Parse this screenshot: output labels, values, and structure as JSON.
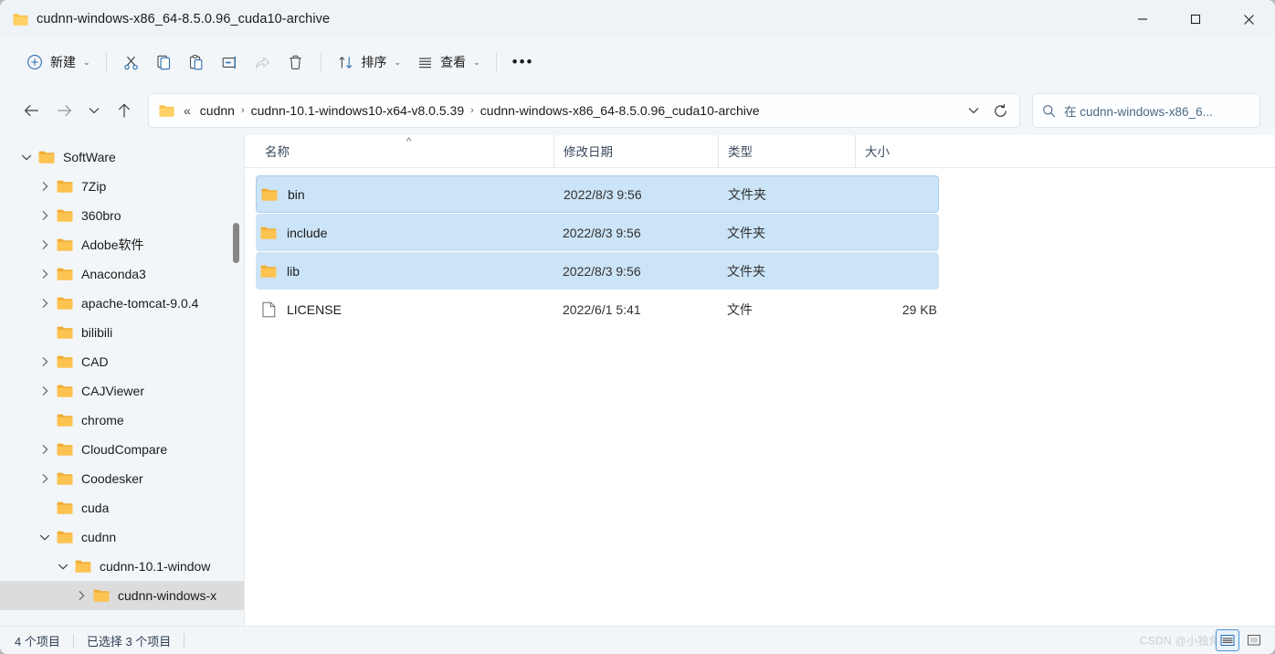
{
  "window": {
    "title": "cudnn-windows-x86_64-8.5.0.96_cuda10-archive",
    "controls": {
      "minimize": "—",
      "maximize": "□",
      "close": "✕"
    }
  },
  "toolbar": {
    "new_label": "新建",
    "cut_label": "剪切",
    "copy_label": "复制",
    "paste_label": "粘贴",
    "rename_label": "重命名",
    "share_label": "共享",
    "delete_label": "删除",
    "sort_label": "排序",
    "view_label": "查看",
    "more_label": "•••",
    "chevron": "⌄"
  },
  "nav": {
    "back": "←",
    "forward": "→",
    "recent": "⌄",
    "up": "↑",
    "refresh_title": "刷新"
  },
  "address": {
    "double_arrow": "«",
    "crumbs": [
      {
        "label": "cudnn"
      },
      {
        "label": "cudnn-10.1-windows10-x64-v8.0.5.39"
      },
      {
        "label": "cudnn-windows-x86_64-8.5.0.96_cuda10-archive"
      }
    ],
    "separator": "›",
    "dropdown_chevron": "⌄"
  },
  "search": {
    "placeholder": "在 cudnn-windows-x86_6..."
  },
  "sidebar": {
    "items": [
      {
        "label": "SoftWare",
        "indent": 0,
        "twisty": "expanded",
        "selected": false
      },
      {
        "label": "7Zip",
        "indent": 1,
        "twisty": "collapsed",
        "selected": false
      },
      {
        "label": "360bro",
        "indent": 1,
        "twisty": "collapsed",
        "selected": false
      },
      {
        "label": "Adobe软件",
        "indent": 1,
        "twisty": "collapsed",
        "selected": false
      },
      {
        "label": "Anaconda3",
        "indent": 1,
        "twisty": "collapsed",
        "selected": false
      },
      {
        "label": "apache-tomcat-9.0.4",
        "indent": 1,
        "twisty": "collapsed",
        "selected": false
      },
      {
        "label": "bilibili",
        "indent": 1,
        "twisty": "none",
        "selected": false
      },
      {
        "label": "CAD",
        "indent": 1,
        "twisty": "collapsed",
        "selected": false
      },
      {
        "label": "CAJViewer",
        "indent": 1,
        "twisty": "collapsed",
        "selected": false
      },
      {
        "label": "chrome",
        "indent": 1,
        "twisty": "none",
        "selected": false
      },
      {
        "label": "CloudCompare",
        "indent": 1,
        "twisty": "collapsed",
        "selected": false
      },
      {
        "label": "Coodesker",
        "indent": 1,
        "twisty": "collapsed",
        "selected": false
      },
      {
        "label": "cuda",
        "indent": 1,
        "twisty": "none",
        "selected": false
      },
      {
        "label": "cudnn",
        "indent": 1,
        "twisty": "expanded",
        "selected": false
      },
      {
        "label": "cudnn-10.1-window",
        "indent": 2,
        "twisty": "expanded",
        "selected": false
      },
      {
        "label": "cudnn-windows-x ",
        "indent": 3,
        "twisty": "collapsed",
        "selected": true
      }
    ]
  },
  "filelist": {
    "columns": [
      {
        "key": "name",
        "label": "名称",
        "sorted": "asc"
      },
      {
        "key": "date",
        "label": "修改日期",
        "sorted": ""
      },
      {
        "key": "type",
        "label": "类型",
        "sorted": ""
      },
      {
        "key": "size",
        "label": "大小",
        "sorted": ""
      }
    ],
    "sort_ascending_glyph": "^",
    "rows": [
      {
        "name": "bin",
        "date": "2022/8/3 9:56",
        "type": "文件夹",
        "size": "",
        "icon": "folder",
        "selected": true,
        "focused": true
      },
      {
        "name": "include",
        "date": "2022/8/3 9:56",
        "type": "文件夹",
        "size": "",
        "icon": "folder",
        "selected": true,
        "focused": false
      },
      {
        "name": "lib",
        "date": "2022/8/3 9:56",
        "type": "文件夹",
        "size": "",
        "icon": "folder",
        "selected": true,
        "focused": false
      },
      {
        "name": "LICENSE",
        "date": "2022/6/1 5:41",
        "type": "文件",
        "size": "29 KB",
        "icon": "file",
        "selected": false,
        "focused": false
      }
    ]
  },
  "statusbar": {
    "item_count": "4 个项目",
    "selected_count": "已选择 3 个项目",
    "watermark": "CSDN @小独角",
    "view_details_label": "详细信息",
    "view_large_icons_label": "大图标"
  },
  "colors": {
    "accent": "#4a93d6",
    "selection": "#cce4f7",
    "folder": "#ffc751",
    "chrome": "#f3f6f9"
  }
}
